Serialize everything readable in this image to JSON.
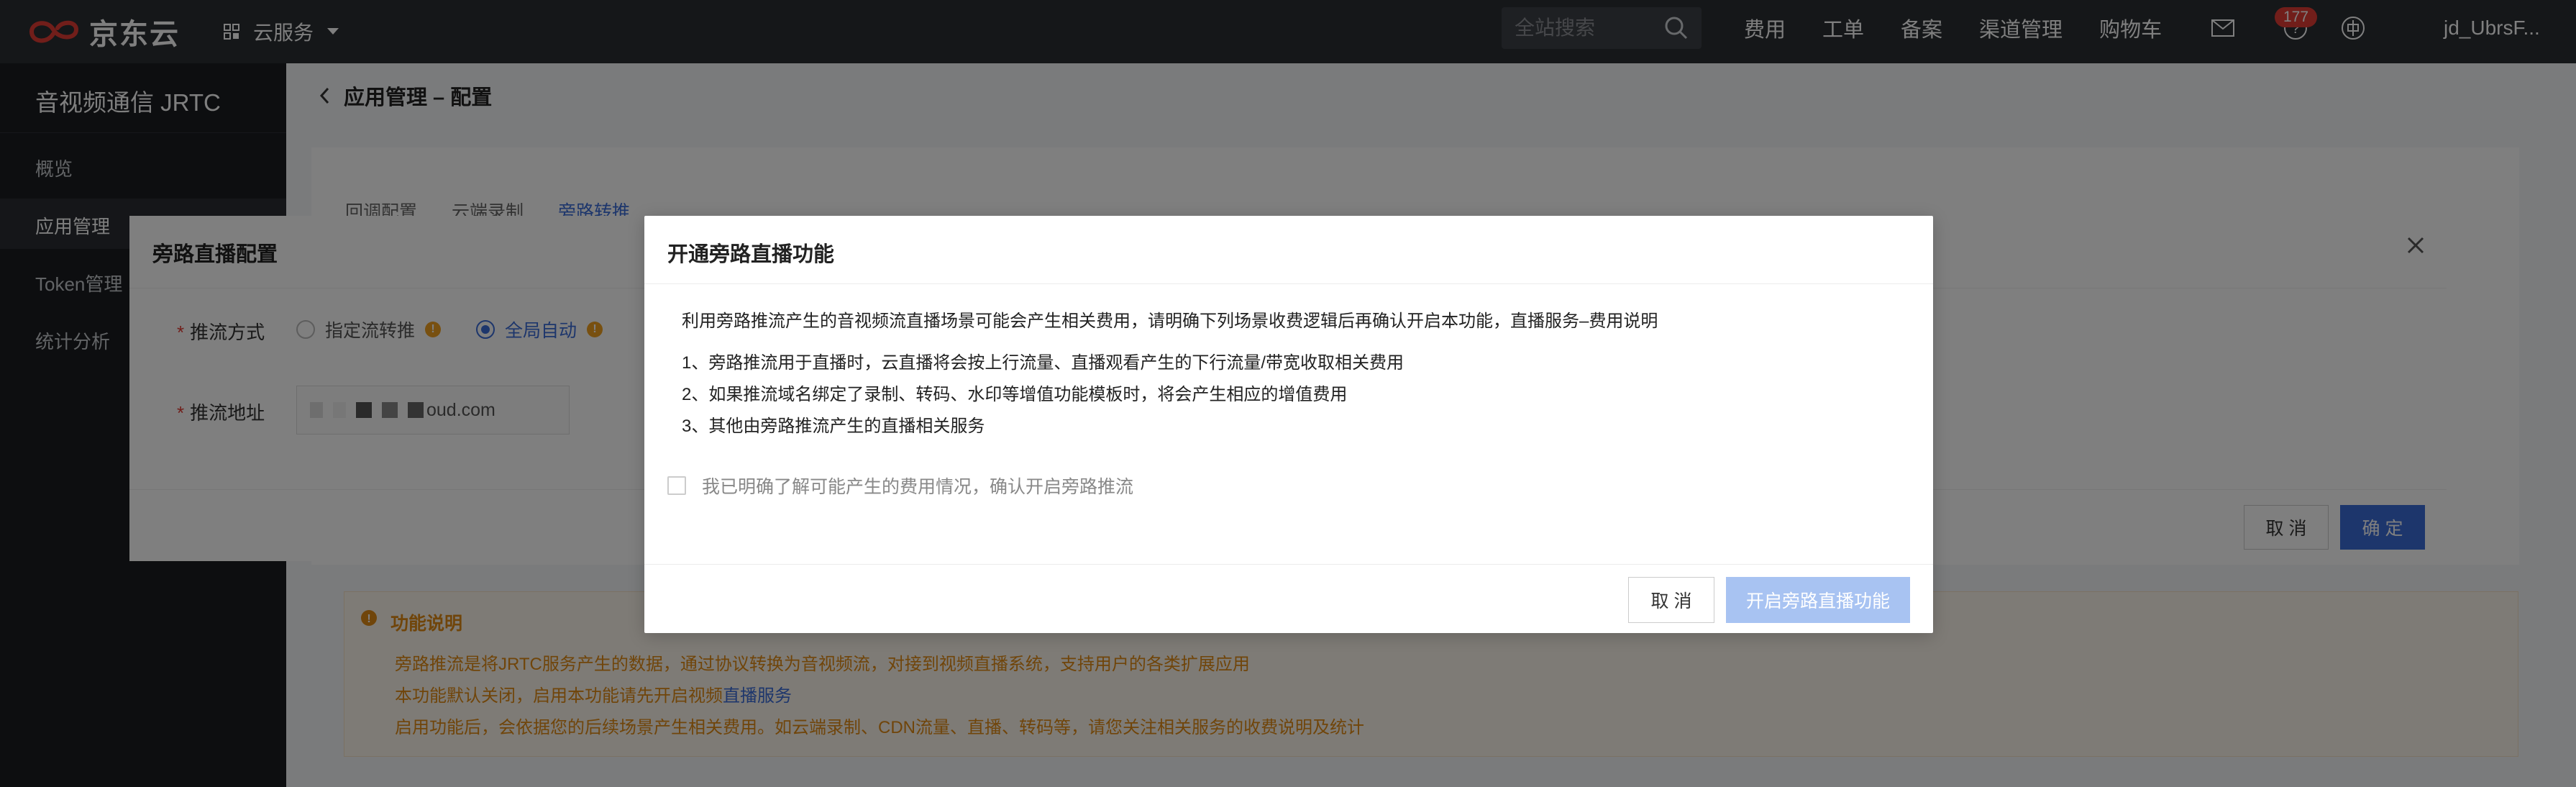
{
  "topnav": {
    "brand": "京东云",
    "service_menu": "云服务",
    "search_placeholder": "全站搜索",
    "links": [
      "费用",
      "工单",
      "备案",
      "渠道管理",
      "购物车"
    ],
    "mail_count": "177",
    "username": "jd_UbrsF..."
  },
  "sidebar": {
    "title": "音视频通信 JRTC",
    "items": [
      "概览",
      "应用管理",
      "Token管理",
      "统计分析"
    ],
    "active_index": 1
  },
  "page": {
    "breadcrumb": "应用管理 – 配置",
    "tabs": [
      "回调配置",
      "云端录制",
      "旁路转推"
    ],
    "active_tab": 2
  },
  "notice": {
    "title": "功能说明",
    "line1": "旁路推流是将JRTC服务产生的数据，通过协议转换为音视频流，对接到视频直播系统，支持用户的各类扩展应用",
    "line2_prefix": "本功能默认关闭，启用本功能请先开启视频",
    "line2_link": "直播服务",
    "line3": "启用功能后，会依据您的后续场景产生相关费用。如云端录制、CDN流量、直播、转码等，请您关注相关服务的收费说明及统计"
  },
  "panel": {
    "title": "旁路直播配置",
    "push_mode_label": "推流方式",
    "option_specified": "指定流转推",
    "option_auto": "全局自动",
    "selected_option": "全局自动",
    "address_label": "推流地址",
    "address_value": "oud.com",
    "cancel": "取 消",
    "confirm": "确 定"
  },
  "modal": {
    "title": "开通旁路直播功能",
    "intro": "利用旁路推流产生的音视频流直播场景可能会产生相关费用，请明确下列场景收费逻辑后再确认开启本功能，直播服务–费用说明",
    "items": [
      "1、旁路推流用于直播时，云直播将会按上行流量、直播观看产生的下行流量/带宽收取相关费用",
      "2、如果推流域名绑定了录制、转码、水印等增值功能模板时，将会产生相应的增值费用",
      "3、其他由旁路推流产生的直播相关服务"
    ],
    "checkbox_label": "我已明确了解可能产生的费用情况，确认开启旁路推流",
    "checkbox_checked": false,
    "cancel": "取 消",
    "confirm": "开启旁路直播功能"
  },
  "colors": {
    "accent": "#3b6cd9",
    "warning": "#e08a14",
    "badge": "#e23c34",
    "disabled_primary": "#a8c3f2"
  }
}
